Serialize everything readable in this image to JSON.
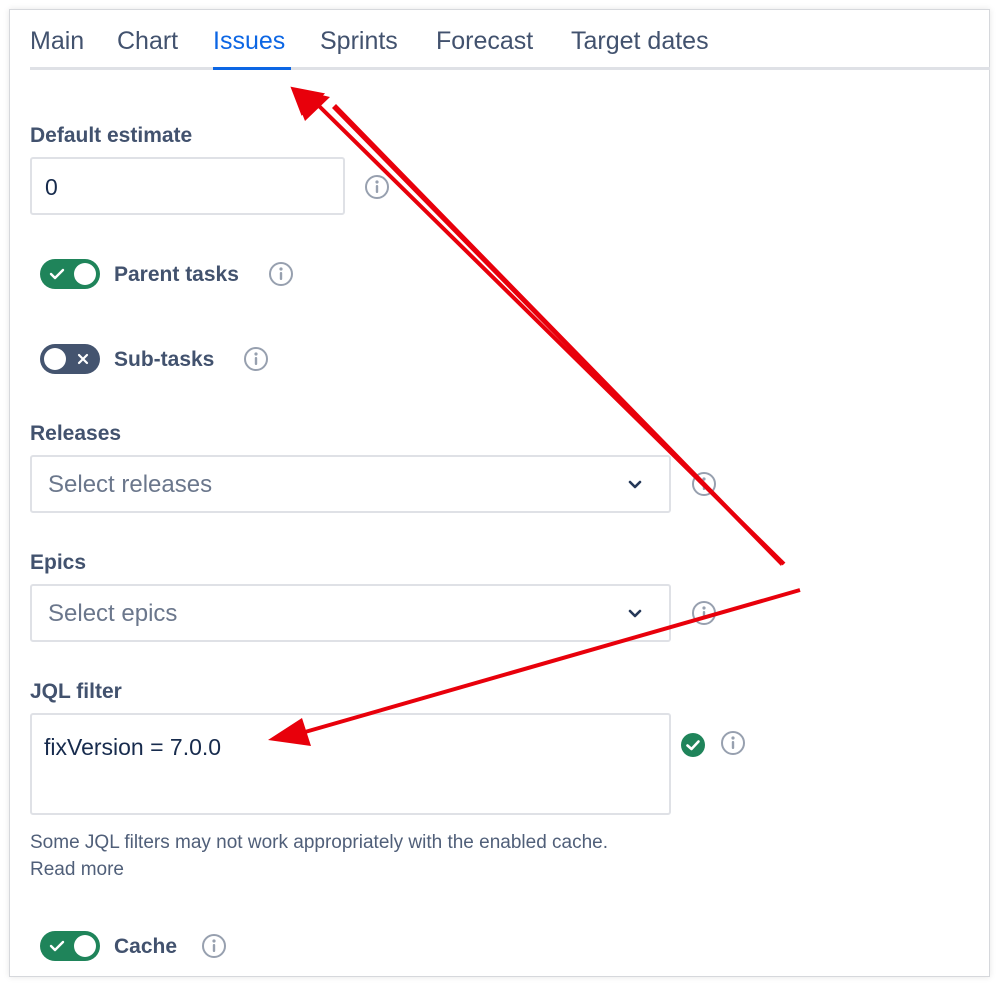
{
  "tabs": [
    {
      "label": "Main"
    },
    {
      "label": "Chart"
    },
    {
      "label": "Issues"
    },
    {
      "label": "Sprints"
    },
    {
      "label": "Forecast"
    },
    {
      "label": "Target dates"
    }
  ],
  "active_tab": "Issues",
  "default_estimate": {
    "label": "Default estimate",
    "value": "0"
  },
  "parent_tasks": {
    "label": "Parent tasks",
    "enabled": true
  },
  "sub_tasks": {
    "label": "Sub-tasks",
    "enabled": false
  },
  "releases": {
    "label": "Releases",
    "placeholder": "Select releases"
  },
  "epics": {
    "label": "Epics",
    "placeholder": "Select epics"
  },
  "jql_filter": {
    "label": "JQL filter",
    "value": "fixVersion = 7.0.0",
    "valid": true,
    "helper_line1": "Some JQL filters may not work appropriately with the enabled cache.",
    "helper_line2": "Read more"
  },
  "cache": {
    "label": "Cache",
    "enabled": true
  },
  "colors": {
    "accent": "#0c66e4",
    "toggle_on": "#1f845a",
    "toggle_off": "#44546f",
    "valid_check": "#1f845a",
    "annotation_arrow": "#e8000b"
  },
  "icons": [
    "info-icon",
    "chevron-down-icon",
    "check-icon",
    "close-icon",
    "check-circle-icon"
  ]
}
